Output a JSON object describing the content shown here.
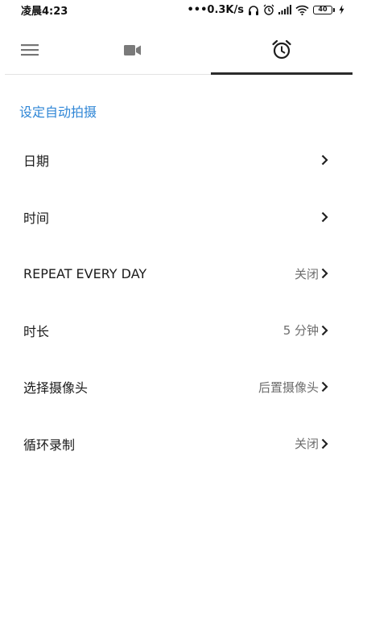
{
  "status_bar": {
    "time": "凌晨4:23",
    "network_speed": "•••0.3K/s",
    "battery_level": "40",
    "icons": [
      "headphones-icon",
      "alarm-icon",
      "signal-icon",
      "wifi-icon",
      "battery-icon",
      "charging-icon"
    ]
  },
  "tabs": [
    {
      "icon": "menu-icon"
    },
    {
      "icon": "video-camera-icon"
    },
    {
      "icon": "alarm-clock-icon",
      "selected": true
    }
  ],
  "section": {
    "title": "设定自动拍摄"
  },
  "settings": [
    {
      "label": "日期",
      "value": ""
    },
    {
      "label": "时间",
      "value": ""
    },
    {
      "label": "REPEAT EVERY DAY",
      "value": "关闭"
    },
    {
      "label": "时长",
      "value": "5 分钟"
    },
    {
      "label": "选择摄像头",
      "value": "后置摄像头"
    },
    {
      "label": "循环录制",
      "value": "关闭"
    }
  ],
  "colors": {
    "accent": "#2f86d6",
    "tab_indicator": "#2b2b2b",
    "secondary_text": "#6d6d6d",
    "icon_gray": "#7a7a7a"
  }
}
